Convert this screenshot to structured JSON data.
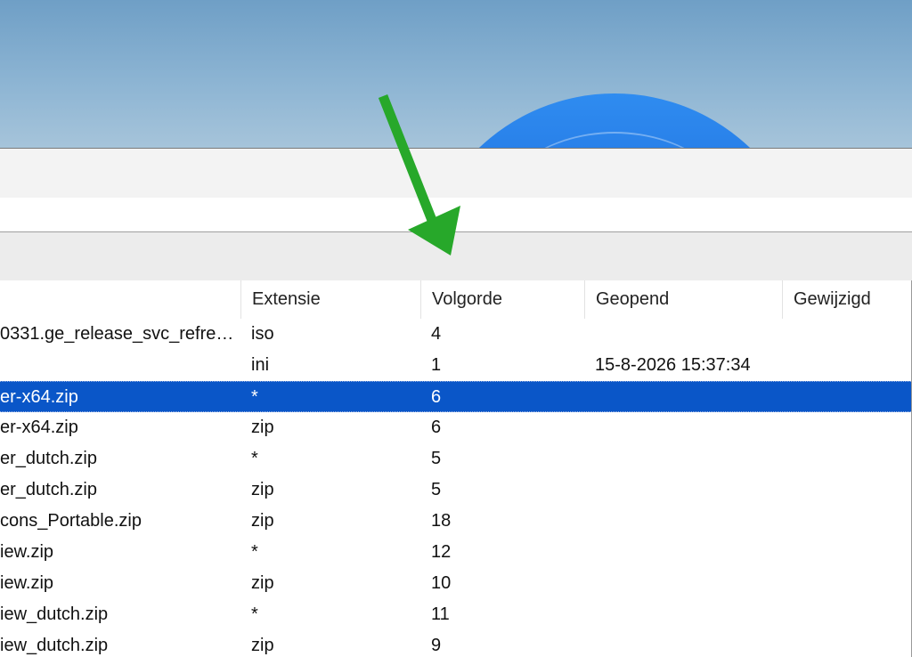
{
  "colors": {
    "selection": "#0a56c8",
    "arrow": "#27a82a"
  },
  "list": {
    "columns": [
      "",
      "Extensie",
      "Volgorde",
      "Geopend",
      "Gewijzigd"
    ],
    "rows": [
      {
        "name": "0331.ge_release_svc_refre…",
        "ext": "iso",
        "order": "4",
        "opened": "",
        "modified": ""
      },
      {
        "name": "",
        "ext": "ini",
        "order": "1",
        "opened": "15-8-2026 15:37:34",
        "modified": ""
      },
      {
        "name": "er-x64.zip",
        "ext": "*",
        "order": "6",
        "opened": "",
        "modified": ""
      },
      {
        "name": "er-x64.zip",
        "ext": "zip",
        "order": "6",
        "opened": "",
        "modified": ""
      },
      {
        "name": "er_dutch.zip",
        "ext": "*",
        "order": "5",
        "opened": "",
        "modified": ""
      },
      {
        "name": "er_dutch.zip",
        "ext": "zip",
        "order": "5",
        "opened": "",
        "modified": ""
      },
      {
        "name": "cons_Portable.zip",
        "ext": "zip",
        "order": "18",
        "opened": "",
        "modified": ""
      },
      {
        "name": "iew.zip",
        "ext": "*",
        "order": "12",
        "opened": "",
        "modified": ""
      },
      {
        "name": "iew.zip",
        "ext": "zip",
        "order": "10",
        "opened": "",
        "modified": ""
      },
      {
        "name": "iew_dutch.zip",
        "ext": "*",
        "order": "11",
        "opened": "",
        "modified": ""
      },
      {
        "name": "iew_dutch.zip",
        "ext": "zip",
        "order": "9",
        "opened": "",
        "modified": ""
      }
    ],
    "selected_row": 2
  }
}
